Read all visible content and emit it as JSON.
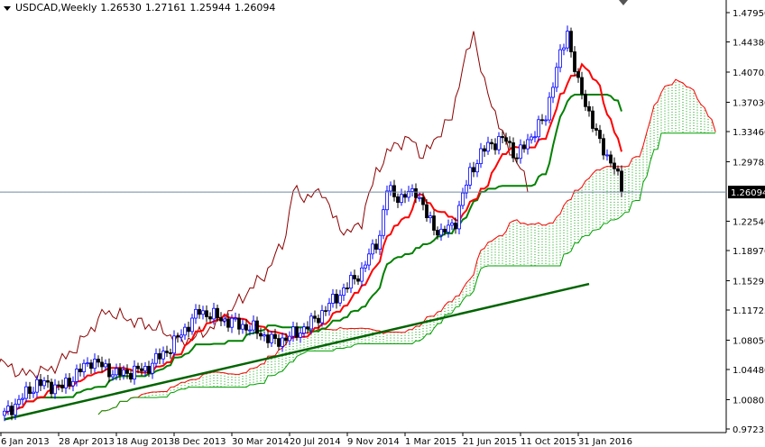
{
  "header": {
    "symbol": "USDCAD,Weekly",
    "open": "1.26530",
    "high": "1.27161",
    "low": "1.25944",
    "close": "1.26094"
  },
  "chart_data": {
    "type": "candlestick",
    "title": "USDCAD,Weekly",
    "indicator": "Ichimoku Kinko Hyo",
    "ylim": [
      0.97235,
      1.4795
    ],
    "y_ticks": [
      "1.47950",
      "1.44380",
      "1.40705",
      "1.37030",
      "1.33460",
      "1.29785",
      "1.22540",
      "1.18970",
      "1.15295",
      "1.11725",
      "1.08050",
      "1.04480",
      "1.00805",
      "0.97235"
    ],
    "current_price": "1.26094",
    "x_ticks": [
      "6 Jan 2013",
      "28 Apr 2013",
      "18 Aug 2013",
      "8 Dec 2013",
      "30 Mar 2014",
      "20 Jul 2014",
      "9 Nov 2014",
      "1 Mar 2015",
      "21 Jun 2015",
      "11 Oct 2015",
      "31 Jan 2016"
    ],
    "close_keypoints": [
      {
        "week": 0,
        "close": 0.99
      },
      {
        "week": 9,
        "close": 1.028
      },
      {
        "week": 16,
        "close": 1.023
      },
      {
        "week": 24,
        "close": 1.056
      },
      {
        "week": 31,
        "close": 1.039
      },
      {
        "week": 39,
        "close": 1.045
      },
      {
        "week": 46,
        "close": 1.072
      },
      {
        "week": 54,
        "close": 1.116
      },
      {
        "week": 61,
        "close": 1.105
      },
      {
        "week": 69,
        "close": 1.094
      },
      {
        "week": 75,
        "close": 1.078
      },
      {
        "week": 81,
        "close": 1.089
      },
      {
        "week": 86,
        "close": 1.105
      },
      {
        "week": 92,
        "close": 1.133
      },
      {
        "week": 99,
        "close": 1.165
      },
      {
        "week": 104,
        "close": 1.209
      },
      {
        "week": 106,
        "close": 1.264
      },
      {
        "week": 110,
        "close": 1.253
      },
      {
        "week": 114,
        "close": 1.264
      },
      {
        "week": 117,
        "close": 1.231
      },
      {
        "week": 121,
        "close": 1.209
      },
      {
        "week": 125,
        "close": 1.226
      },
      {
        "week": 129,
        "close": 1.286
      },
      {
        "week": 134,
        "close": 1.319
      },
      {
        "week": 139,
        "close": 1.325
      },
      {
        "week": 142,
        "close": 1.303
      },
      {
        "week": 146,
        "close": 1.33
      },
      {
        "week": 150,
        "close": 1.352
      },
      {
        "week": 152,
        "close": 1.396
      },
      {
        "week": 156,
        "close": 1.456
      },
      {
        "week": 159,
        "close": 1.391
      },
      {
        "week": 162,
        "close": 1.358
      },
      {
        "week": 165,
        "close": 1.319
      },
      {
        "week": 169,
        "close": 1.292
      },
      {
        "week": 171,
        "close": 1.261
      }
    ],
    "trendline": {
      "start": {
        "week": 0,
        "price": 0.984
      },
      "end": {
        "week": 162,
        "price": 1.149
      }
    },
    "colors": {
      "up": "#0000ff",
      "down": "#000000",
      "tenkan": "#ff0000",
      "kijun": "#008000",
      "chikou": "#8b0000",
      "cloud_up": "#00a000",
      "cloud_down": "#ff0000",
      "trendline": "#006400",
      "grid": "#6e8aa0"
    }
  }
}
